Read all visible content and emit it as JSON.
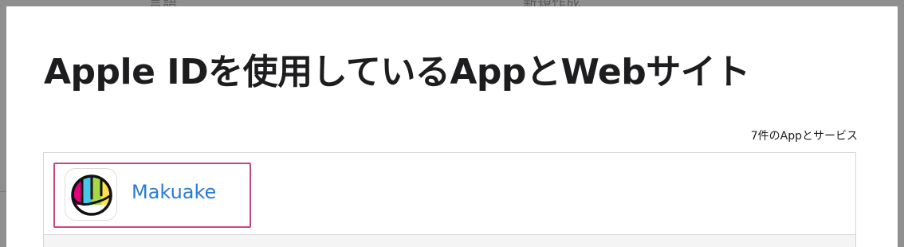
{
  "backdrop": {
    "text_left": "言語",
    "text_right": "新規作成"
  },
  "modal": {
    "title": "Apple IDを使用しているAppとWebサイト",
    "count": "7件のAppとサービス"
  },
  "apps": [
    {
      "name": "Makuake",
      "icon": "makuake-logo-icon"
    }
  ],
  "colors": {
    "link": "#2a7bd6",
    "highlight": "#c8467f",
    "title": "#1d1d1f"
  }
}
